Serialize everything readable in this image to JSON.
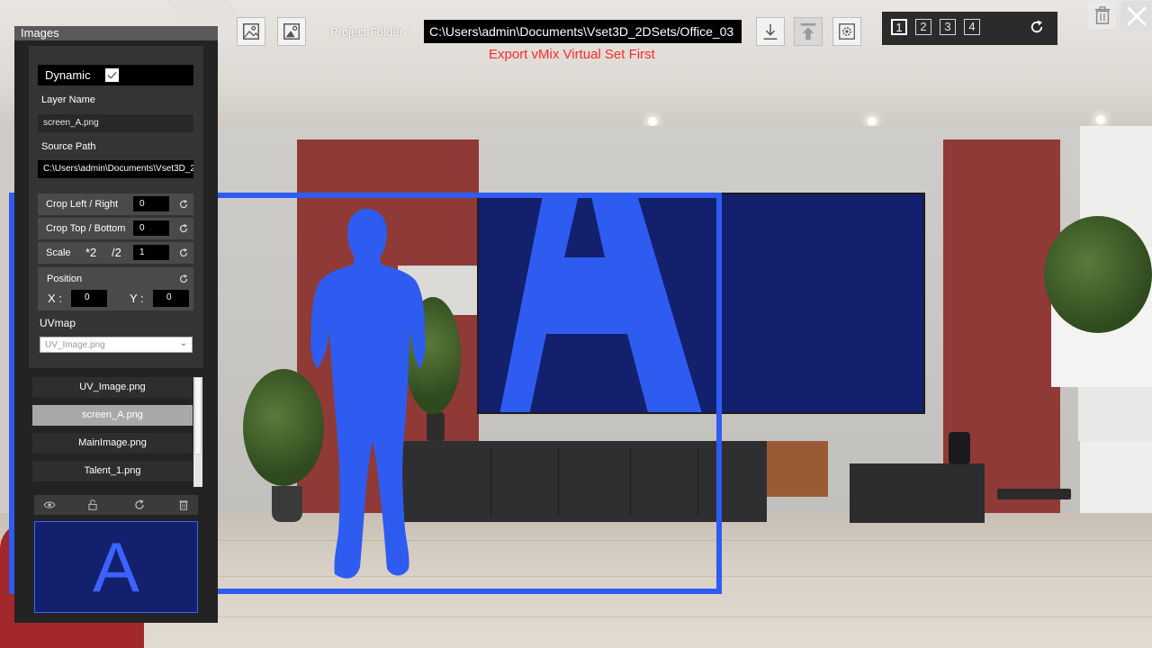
{
  "toolbar": {
    "project_label": "Project Folder :",
    "project_path": "C:\\Users\\admin\\Documents\\Vset3D_2DSets/Office_03",
    "export_warning": "Export vMix Virtual Set First"
  },
  "tabs": [
    {
      "label": "1",
      "active": true
    },
    {
      "label": "2",
      "active": false
    },
    {
      "label": "3",
      "active": false
    },
    {
      "label": "4",
      "active": false
    }
  ],
  "panel": {
    "title": "Images",
    "dynamic_label": "Dynamic",
    "dynamic_checked": true,
    "layer_name_label": "Layer Name",
    "layer_name_value": "screen_A.png",
    "source_path_label": "Source Path",
    "source_path_value": "C:\\Users\\admin\\Documents\\Vset3D_2D",
    "crop_lr_label": "Crop Left / Right",
    "crop_lr_value": "0",
    "crop_tb_label": "Crop Top / Bottom",
    "crop_tb_value": "0",
    "scale_label": "Scale",
    "scale_mul": "*2",
    "scale_div": "/2",
    "scale_value": "1",
    "position_label": "Position",
    "x_label": "X :",
    "x_value": "0",
    "y_label": "Y :",
    "y_value": "0",
    "uvmap_label": "UVmap",
    "uvmap_value": "UV_Image.png",
    "layers": [
      {
        "name": "UV_Image.png",
        "selected": false
      },
      {
        "name": "screen_A.png",
        "selected": true
      },
      {
        "name": "MainImage.png",
        "selected": false
      },
      {
        "name": "Talent_1.png",
        "selected": false
      }
    ],
    "preview_letter": "A"
  },
  "colors": {
    "accent_blue": "#2f5cf0",
    "screen_navy": "#13206e",
    "warning_red": "#ff2a2a",
    "panel_bg": "#232323"
  },
  "icons": {
    "add_image": "image-icon",
    "add_image_alt": "image-settings-icon",
    "import": "download-icon",
    "export": "upload-icon",
    "settings": "gear-icon",
    "refresh": "refresh-icon",
    "trash": "trash-icon",
    "close": "close-icon",
    "visibility": "eye-icon",
    "lock": "lock-icon"
  }
}
